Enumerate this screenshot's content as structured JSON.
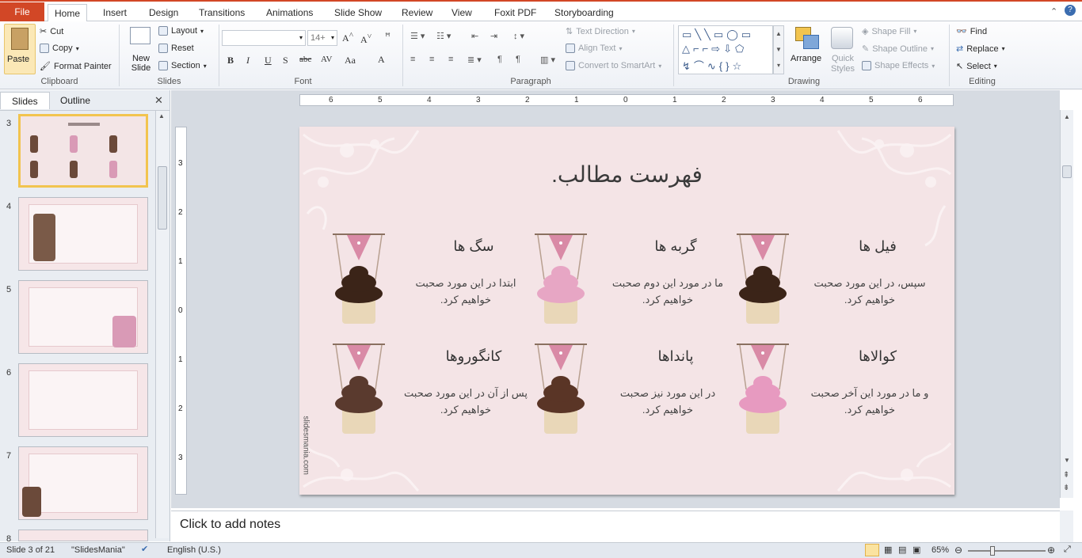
{
  "ribbon_tabs": [
    "File",
    "Home",
    "Insert",
    "Design",
    "Transitions",
    "Animations",
    "Slide Show",
    "Review",
    "View",
    "Foxit PDF",
    "Storyboarding"
  ],
  "clipboard": {
    "paste": "Paste",
    "cut": "Cut",
    "copy": "Copy",
    "format_painter": "Format Painter",
    "label": "Clipboard"
  },
  "slides_group": {
    "new_slide": "New Slide",
    "layout": "Layout",
    "reset": "Reset",
    "section": "Section",
    "label": "Slides"
  },
  "font_group": {
    "font_name": "",
    "font_size": "14+",
    "label": "Font",
    "buttons": [
      "B",
      "I",
      "U",
      "S",
      "abc",
      "AV",
      "Aa",
      "A"
    ]
  },
  "paragraph_group": {
    "text_direction": "Text Direction",
    "align_text": "Align Text",
    "convert_smartart": "Convert to SmartArt",
    "label": "Paragraph"
  },
  "drawing_group": {
    "arrange": "Arrange",
    "quick_styles": "Quick Styles",
    "shape_fill": "Shape Fill",
    "shape_outline": "Shape Outline",
    "shape_effects": "Shape Effects",
    "label": "Drawing"
  },
  "editing_group": {
    "find": "Find",
    "replace": "Replace",
    "select": "Select",
    "label": "Editing"
  },
  "left_panel": {
    "tabs": [
      "Slides",
      "Outline"
    ],
    "thumbnails": [
      {
        "num": "3",
        "selected": true
      },
      {
        "num": "4",
        "selected": false
      },
      {
        "num": "5",
        "selected": false
      },
      {
        "num": "6",
        "selected": false
      },
      {
        "num": "7",
        "selected": false
      },
      {
        "num": "8",
        "selected": false
      }
    ]
  },
  "ruler_numbers": [
    "6",
    "5",
    "4",
    "3",
    "2",
    "1",
    "0",
    "1",
    "2",
    "3",
    "4",
    "5",
    "6"
  ],
  "vruler_numbers": [
    "3",
    "2",
    "1",
    "0",
    "1",
    "2",
    "3"
  ],
  "slide": {
    "title": "فهرست مطالب.",
    "watermark": "slidesmania.com",
    "items": [
      {
        "title": "فیل ها",
        "desc": "سپس، در این مورد صحبت خواهیم کرد.",
        "frosting": "#3b2418"
      },
      {
        "title": "گربه ها",
        "desc": "ما در مورد این دوم صحبت خواهیم کرد.",
        "frosting": "#e7a6c4"
      },
      {
        "title": "سگ ها",
        "desc": "ابتدا در این مورد صحبت خواهیم کرد.",
        "frosting": "#3b2418"
      },
      {
        "title": "کوالاها",
        "desc": "و ما در مورد این آخر صحبت خواهیم کرد.",
        "frosting": "#e79ac0"
      },
      {
        "title": "پانداها",
        "desc": "در این مورد نیز صحبت خواهیم کرد.",
        "frosting": "#5a3526"
      },
      {
        "title": "کانگوروها",
        "desc": "پس از آن در این مورد صحبت خواهیم کرد.",
        "frosting": "#5a3a2e"
      }
    ]
  },
  "notes_placeholder": "Click to add notes",
  "status": {
    "slide_info": "Slide 3 of 21",
    "theme": "\"SlidesMania\"",
    "language": "English (U.S.)",
    "zoom": "65%"
  },
  "colors": {
    "file_tab": "#d24726",
    "slide_bg": "#f4e4e6",
    "pennant": "#d98aa6",
    "selection": "#f2c44f"
  }
}
